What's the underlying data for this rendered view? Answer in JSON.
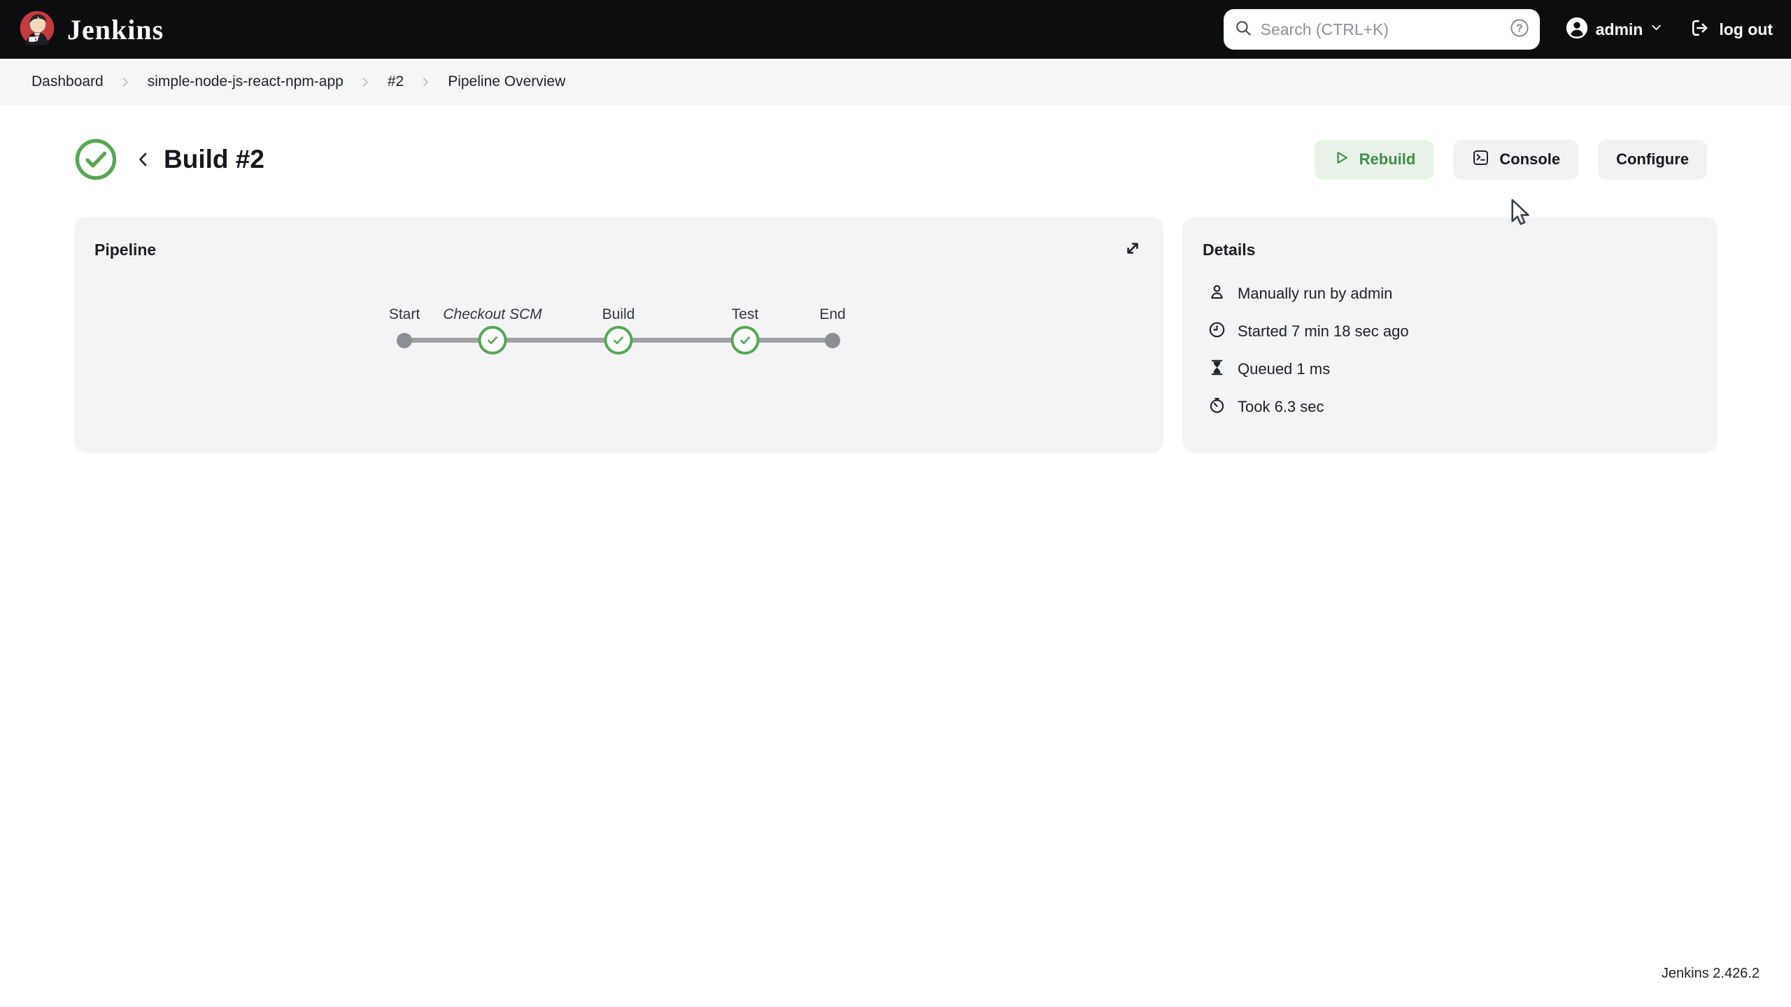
{
  "navbar": {
    "brand": "Jenkins",
    "search": {
      "placeholder": "Search (CTRL+K)"
    },
    "user": {
      "name": "admin"
    },
    "logout_label": "log out"
  },
  "breadcrumb": {
    "items": [
      "Dashboard",
      "simple-node-js-react-npm-app",
      "#2",
      "Pipeline Overview"
    ]
  },
  "build_header": {
    "title": "Build #2",
    "status": "success"
  },
  "actions": {
    "rebuild": "Rebuild",
    "console": "Console",
    "configure": "Configure"
  },
  "pipeline": {
    "title": "Pipeline",
    "stages": [
      {
        "label": "Start",
        "type": "terminal"
      },
      {
        "label": "Checkout SCM",
        "type": "success"
      },
      {
        "label": "Build",
        "type": "success"
      },
      {
        "label": "Test",
        "type": "success"
      },
      {
        "label": "End",
        "type": "terminal"
      }
    ]
  },
  "details": {
    "title": "Details",
    "items": [
      {
        "icon": "user-icon",
        "text": "Manually run by admin"
      },
      {
        "icon": "clock-icon",
        "text": "Started 7 min 18 sec ago"
      },
      {
        "icon": "hourglass-icon",
        "text": "Queued 1 ms"
      },
      {
        "icon": "stopwatch-icon",
        "text": "Took 6.3 sec"
      }
    ]
  },
  "footer": {
    "version": "Jenkins 2.426.2"
  },
  "colors": {
    "navbar_bg": "#0b0d0f",
    "breadcrumb_bg": "#f6f6f8",
    "card_bg": "#f4f4f6",
    "success_green": "#56a753",
    "rebuild_bg": "#e9f2e9",
    "rebuild_text": "#3f8f4b",
    "connector_gray": "#9fa1a4",
    "terminal_dot_gray": "#8b8e92"
  }
}
